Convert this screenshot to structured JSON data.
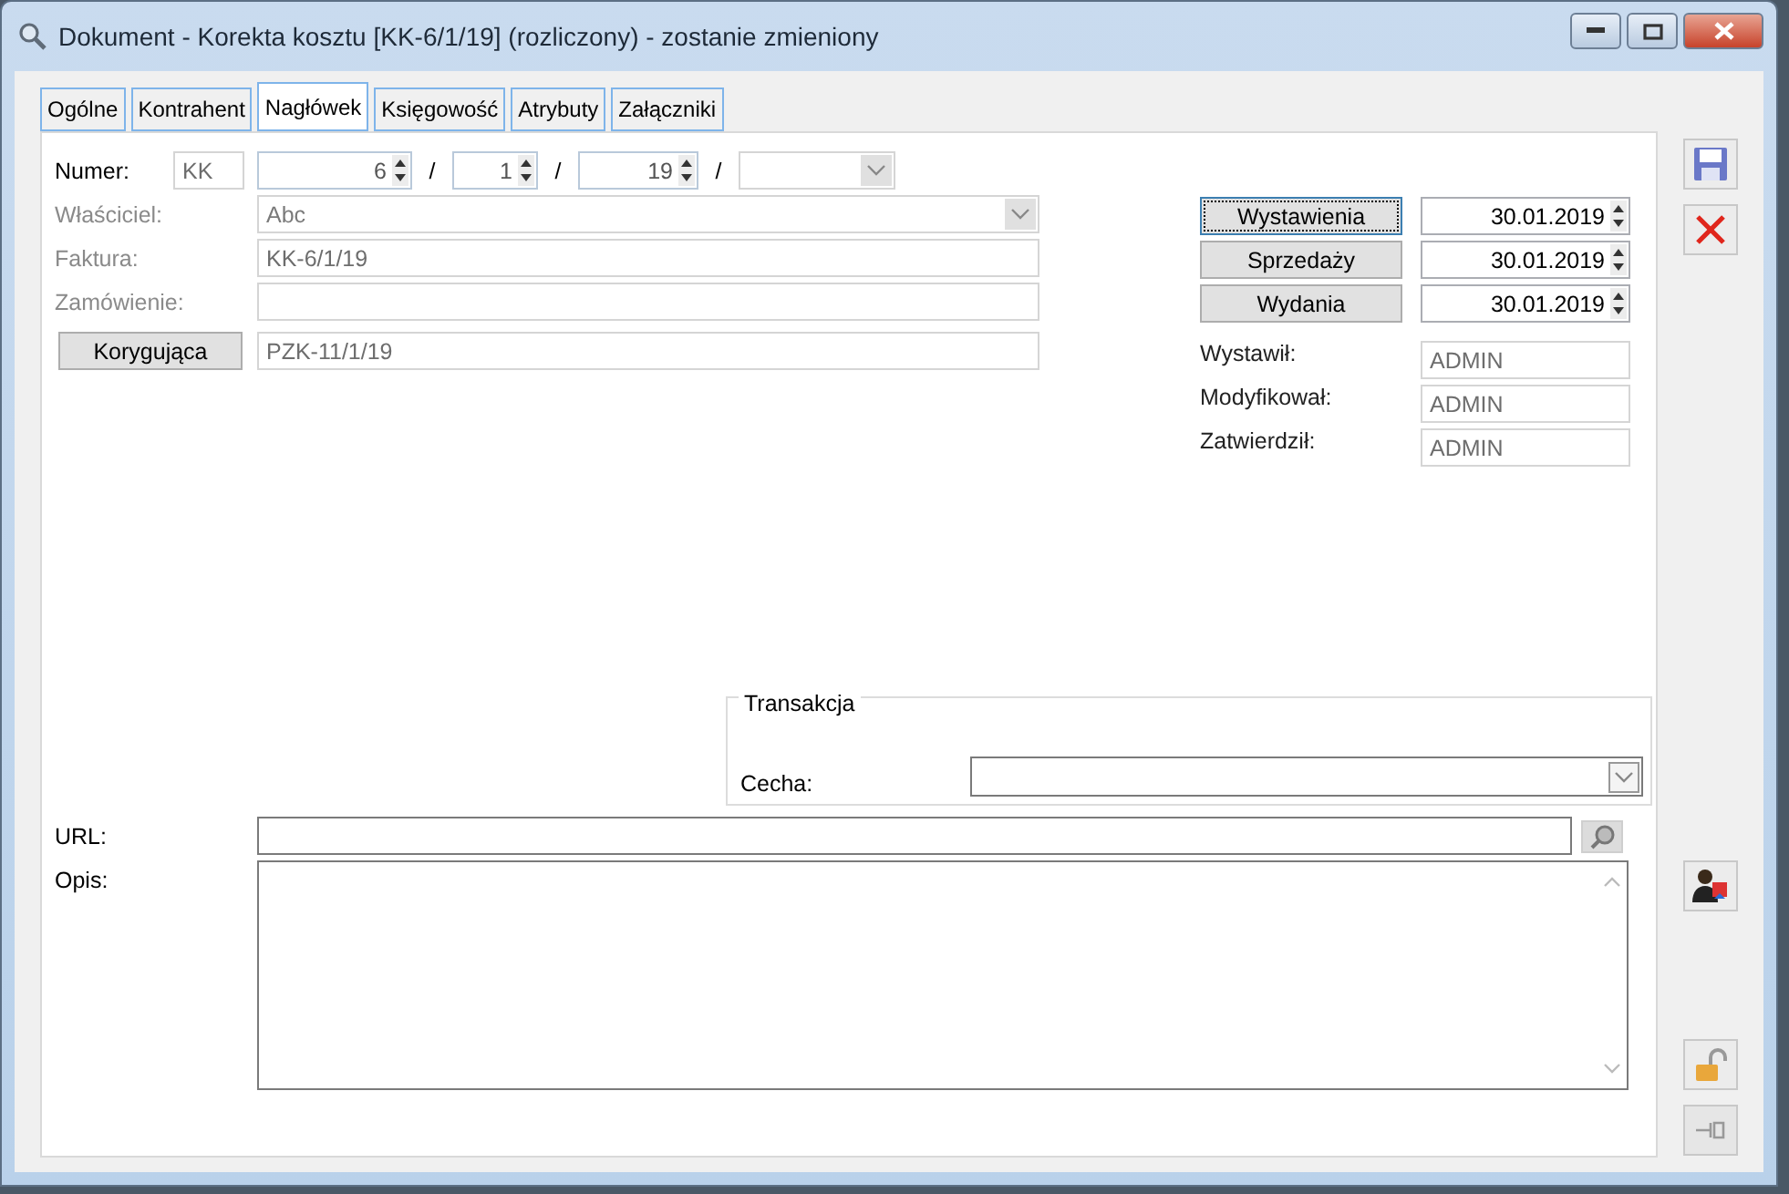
{
  "window": {
    "title": "Dokument - Korekta kosztu [KK-6/1/19] (rozliczony) - zostanie zmieniony"
  },
  "tabs": [
    {
      "label": "Ogólne",
      "selected": false
    },
    {
      "label": "Kontrahent",
      "selected": false
    },
    {
      "label": "Nagłówek",
      "selected": true
    },
    {
      "label": "Księgowość",
      "selected": false
    },
    {
      "label": "Atrybuty",
      "selected": false
    },
    {
      "label": "Załączniki",
      "selected": false
    }
  ],
  "numer": {
    "label": "Numer:",
    "prefix": "KK",
    "parts": [
      "6",
      "1",
      "19"
    ],
    "separators": [
      "/",
      "/",
      "/"
    ]
  },
  "rows": [
    {
      "kind": "combo",
      "label": "Właściciel:",
      "value": "Abc",
      "disabled": true
    },
    {
      "kind": "text",
      "label": "Faktura:",
      "value": "KK-6/1/19",
      "disabled": true
    },
    {
      "kind": "text",
      "label": "Zamówienie:",
      "disabled": true
    },
    {
      "kind": "button",
      "label": "Korygująca",
      "value": "PZK-11/1/19",
      "disabled": false
    }
  ],
  "dates": [
    {
      "label": "Wystawienia",
      "value": "30.01.2019",
      "focused": true
    },
    {
      "label": "Sprzedaży",
      "value": "30.01.2019",
      "focused": false
    },
    {
      "label": "Wydania",
      "value": "30.01.2019",
      "focused": false
    }
  ],
  "users": [
    {
      "label": "Wystawił:",
      "value": "ADMIN"
    },
    {
      "label": "Modyfikował:",
      "value": "ADMIN"
    },
    {
      "label": "Zatwierdził:",
      "value": "ADMIN"
    }
  ],
  "transakcja": {
    "title": "Transakcja",
    "cecha_label": "Cecha:"
  },
  "url": {
    "label": "URL:"
  },
  "opis": {
    "label": "Opis:"
  }
}
